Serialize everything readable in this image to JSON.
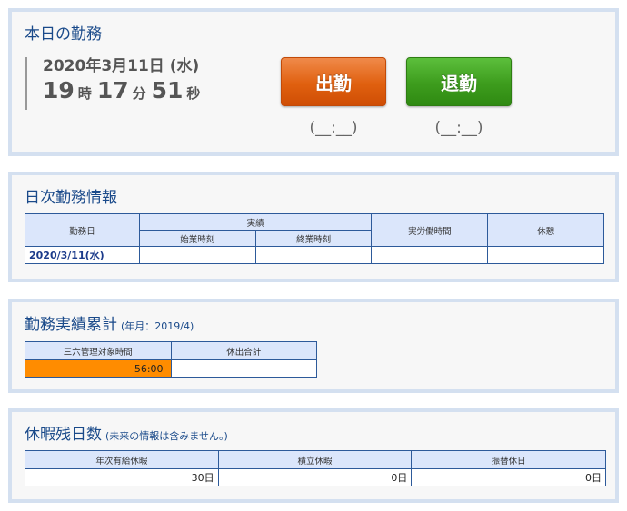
{
  "today": {
    "title": "本日の勤務",
    "date": "2020年3月11日 (水)",
    "hours": "19",
    "hours_unit": "時",
    "minutes": "17",
    "minutes_unit": "分",
    "seconds": "51",
    "seconds_unit": "秒",
    "clock_in_label": "出勤",
    "clock_out_label": "退勤",
    "clock_in_time": "(__:__)",
    "clock_out_time": "(__:__)"
  },
  "daily": {
    "title": "日次勤務情報",
    "headers": {
      "work_date": "勤務日",
      "actual": "実績",
      "start_time": "始業時刻",
      "end_time": "終業時刻",
      "actual_hours": "実労働時間",
      "break": "休憩"
    },
    "row": {
      "date": "2020/3/11(水)",
      "start_time": "",
      "end_time": "",
      "actual_hours": "",
      "break": ""
    }
  },
  "cumulative": {
    "title": "勤務実績累計",
    "subtitle": "(年月：2019/4)",
    "headers": [
      "三六管理対象時間",
      "休出合計"
    ],
    "values": [
      "56:00",
      ""
    ],
    "colors": {
      "over_limit": "#ff8c00"
    }
  },
  "leave": {
    "title": "休暇残日数",
    "subtitle": "(未来の情報は含みません。)",
    "headers": [
      "年次有給休暇",
      "積立休暇",
      "振替休日"
    ],
    "values": [
      "30日",
      "0日",
      "0日"
    ]
  },
  "colors": {
    "clock_in": "#e0600f",
    "clock_out": "#3d9c1d",
    "panel_border": "#d4e0f0",
    "title_text": "#1a4a8a"
  }
}
